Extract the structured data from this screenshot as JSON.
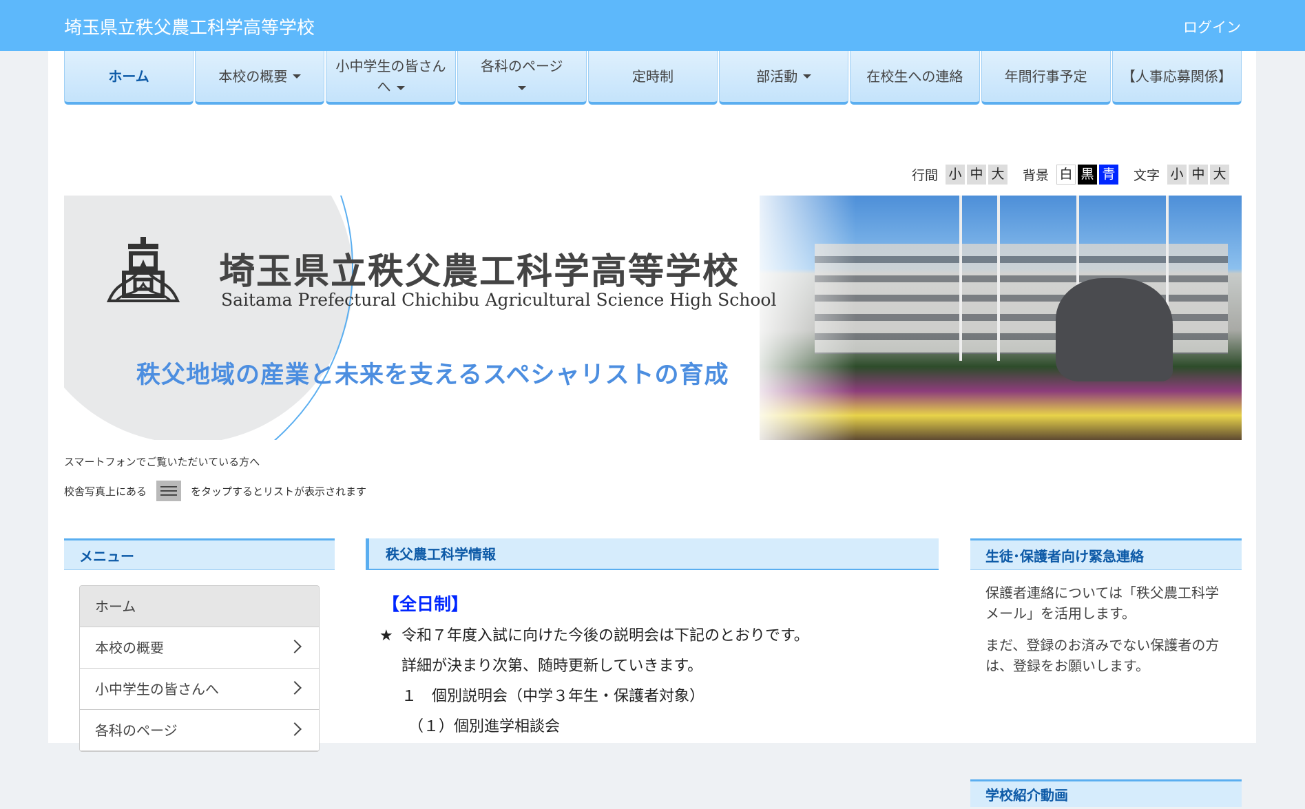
{
  "header": {
    "site_title": "埼玉県立秩父農工科学高等学校",
    "login": "ログイン"
  },
  "nav": {
    "items": [
      {
        "label": "ホーム",
        "dropdown": false,
        "active": true
      },
      {
        "label": "本校の概要",
        "dropdown": true
      },
      {
        "label": "小中学生の皆さんへ",
        "dropdown": true
      },
      {
        "label": "各科のページ",
        "dropdown": true
      },
      {
        "label": "定時制",
        "dropdown": false
      },
      {
        "label": "部活動",
        "dropdown": true
      },
      {
        "label": "在校生への連絡",
        "dropdown": false
      },
      {
        "label": "年間行事予定",
        "dropdown": false
      },
      {
        "label": "【人事応募関係】",
        "dropdown": false
      }
    ]
  },
  "a11y": {
    "line_spacing_label": "行間",
    "background_label": "背景",
    "text_label": "文字",
    "size_small": "小",
    "size_medium": "中",
    "size_large": "大",
    "bg_white": "白",
    "bg_black": "黒",
    "bg_blue": "青"
  },
  "banner": {
    "school_name_jp": "埼玉県立秩父農工科学高等学校",
    "school_name_en": "Saitama Prefectural Chichibu Agricultural Science High School",
    "slogan": "秩父地域の産業と未来を支えるスペシャリストの育成"
  },
  "notes": {
    "smartphone": "スマートフォンでご覧いただいている方へ",
    "tap_prefix": "校舎写真上にある",
    "tap_suffix": "をタップするとリストが表示されます"
  },
  "left": {
    "heading": "メニュー",
    "menu": [
      {
        "label": "ホーム",
        "active": true,
        "has_children": false
      },
      {
        "label": "本校の概要",
        "has_children": true
      },
      {
        "label": "小中学生の皆さんへ",
        "has_children": true
      },
      {
        "label": "各科のページ",
        "has_children": true
      }
    ]
  },
  "center": {
    "heading": "秩父農工科学情報",
    "full_day": "【全日制】",
    "star": "★",
    "line1": "令和７年度入試に向けた今後の説明会は下記のとおりです。",
    "line2": "詳細が決まり次第、随時更新していきます。",
    "item1": "１　個別説明会（中学３年生・保護者対象）",
    "item1_sub": "（１）個別進学相談会"
  },
  "right": {
    "heading": "生徒･保護者向け緊急連絡",
    "para1": "保護者連絡については「秩父農工科学メール」を活用します。",
    "para2": "まだ、登録のお済みでない保護者の方は、登録をお願いします。",
    "heading2": "学校紹介動画"
  },
  "colors": {
    "header_bg": "#5db8fb",
    "accent": "#5aaef0",
    "heading_text": "#0d5aa7",
    "full_day_text": "#0026ff"
  }
}
